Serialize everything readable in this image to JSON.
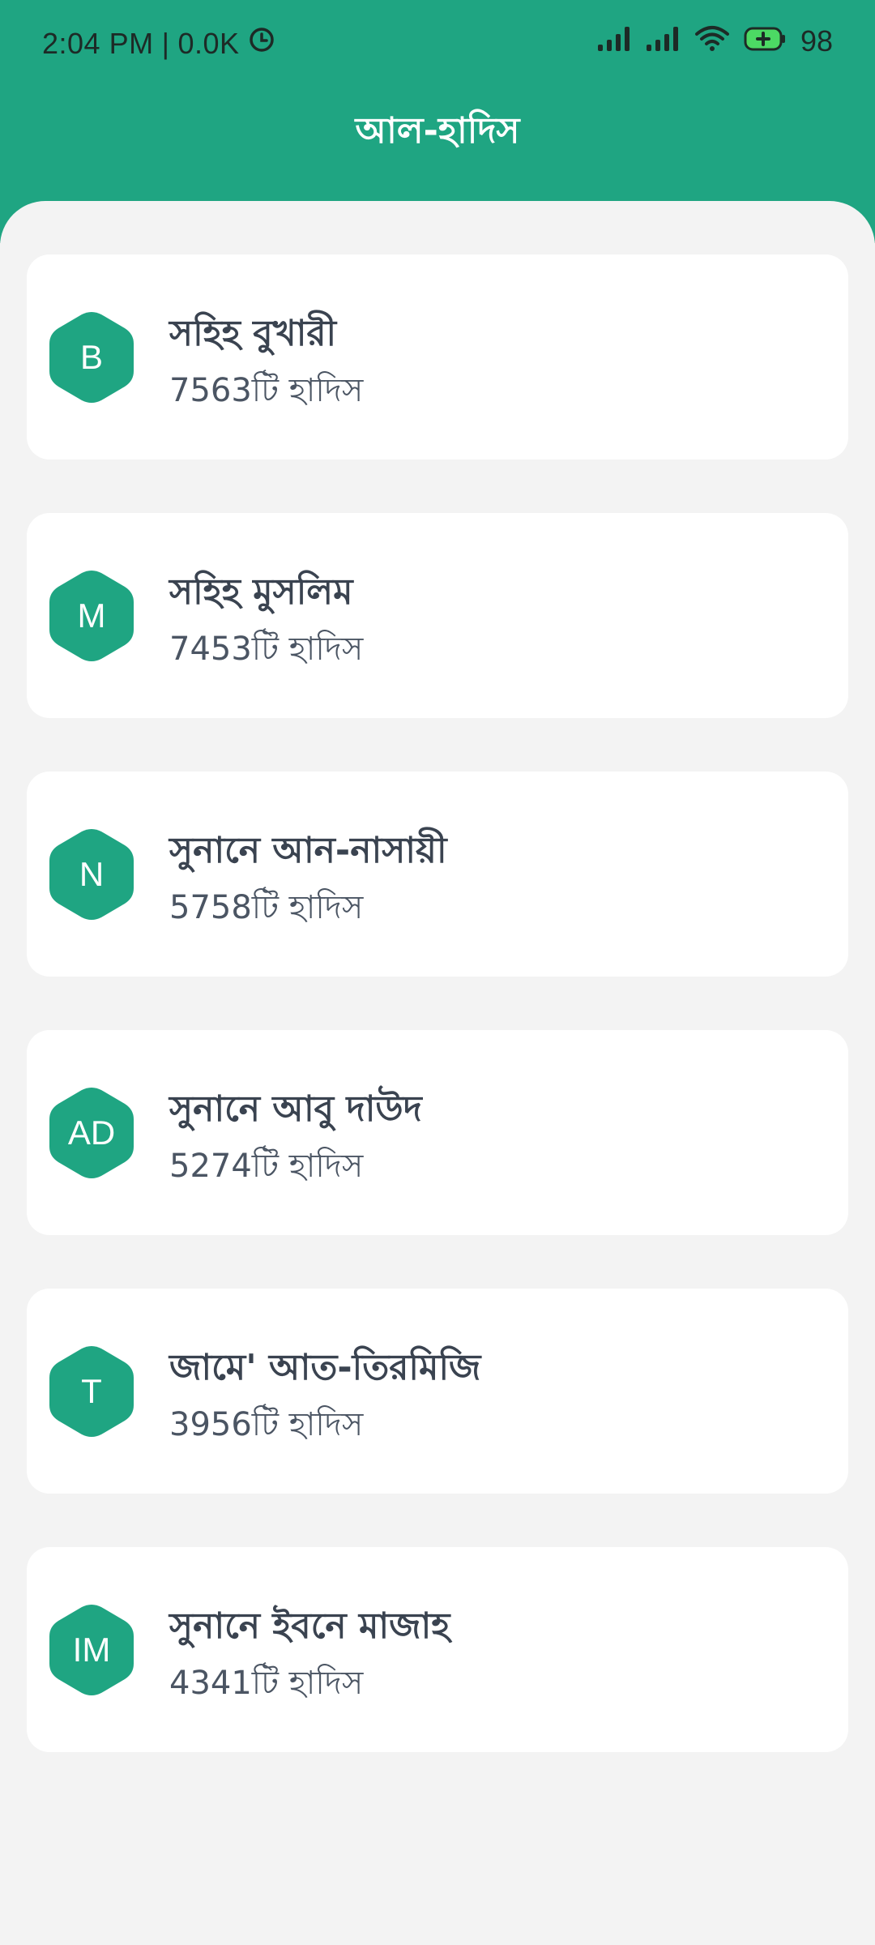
{
  "status_bar": {
    "time": "2:04 PM",
    "separator": "|",
    "network_speed": "0.0K",
    "battery_level": "98",
    "icons": [
      "alarm-icon",
      "signal-icon",
      "signal-icon",
      "wifi-icon",
      "battery-charging-icon"
    ]
  },
  "header": {
    "title": "আল-হাদিস"
  },
  "colors": {
    "accent": "#1fa582",
    "background": "#f3f3f3",
    "card": "#ffffff",
    "text_primary": "#3a4350",
    "battery_fill": "#4cd964"
  },
  "books": [
    {
      "badge": "B",
      "name": "সহিহ বুখারী",
      "count": "7563টি হাদিস"
    },
    {
      "badge": "M",
      "name": "সহিহ মুসলিম",
      "count": "7453টি হাদিস"
    },
    {
      "badge": "N",
      "name": "সুনানে আন-নাসায়ী",
      "count": "5758টি হাদিস"
    },
    {
      "badge": "AD",
      "name": "সুনানে আবু দাউদ",
      "count": "5274টি হাদিস"
    },
    {
      "badge": "T",
      "name": "জামে' আত-তিরমিজি",
      "count": "3956টি হাদিস"
    },
    {
      "badge": "IM",
      "name": "সুনানে ইবনে মাজাহ",
      "count": "4341টি হাদিস"
    }
  ]
}
